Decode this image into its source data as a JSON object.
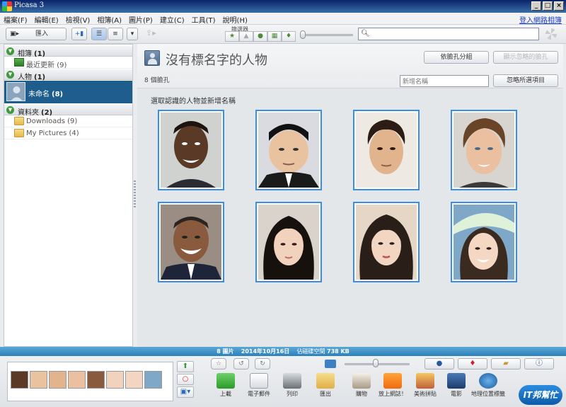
{
  "window": {
    "title": "Picasa 3"
  },
  "menu": {
    "items": [
      "檔案(F)",
      "編輯(E)",
      "檢視(V)",
      "相簿(A)",
      "圖片(P)",
      "建立(C)",
      "工具(T)",
      "說明(H)"
    ],
    "signin": "登入網路相簿"
  },
  "toolbar": {
    "import_label": "匯入",
    "filter_label": "篩選器",
    "search_placeholder": ""
  },
  "sidebar": {
    "albums": {
      "label": "相簿",
      "count": "(1)"
    },
    "recent": {
      "label": "最近更新",
      "count": "(9)"
    },
    "people": {
      "label": "人物",
      "count": "(1)"
    },
    "unnamed": {
      "label": "未命名",
      "count": "(8)"
    },
    "folders": {
      "label": "資料夾",
      "count": "(2)"
    },
    "folder_items": [
      {
        "label": "Downloads",
        "count": "(9)"
      },
      {
        "label": "My Pictures",
        "count": "(4)"
      }
    ]
  },
  "main": {
    "title": "沒有標名字的人物",
    "face_count": "8 個臉孔",
    "group_button": "依臉孔分組",
    "show_ignored_button": "顯示忽略的臉孔",
    "name_placeholder": "新增名稱",
    "ignore_button": "忽略所選項目",
    "instruction": "選取認識的人物並新增名稱"
  },
  "status": {
    "images": "8 圖片",
    "date": "2014年10月16日",
    "disk_label": "佔磁碟空間",
    "size": "738 KB"
  },
  "tray": {
    "tools": [
      "上載",
      "電子郵件",
      "列印",
      "匯出",
      "購物",
      "放上網誌！",
      "美術拼貼",
      "電影",
      "地理位置標籤"
    ]
  },
  "logo": {
    "text": "IT邦幫忙"
  },
  "colors": {
    "selection": "#1f5e8c",
    "tile_border": "#3a8ee6",
    "status_bar": "#2c80bb"
  }
}
